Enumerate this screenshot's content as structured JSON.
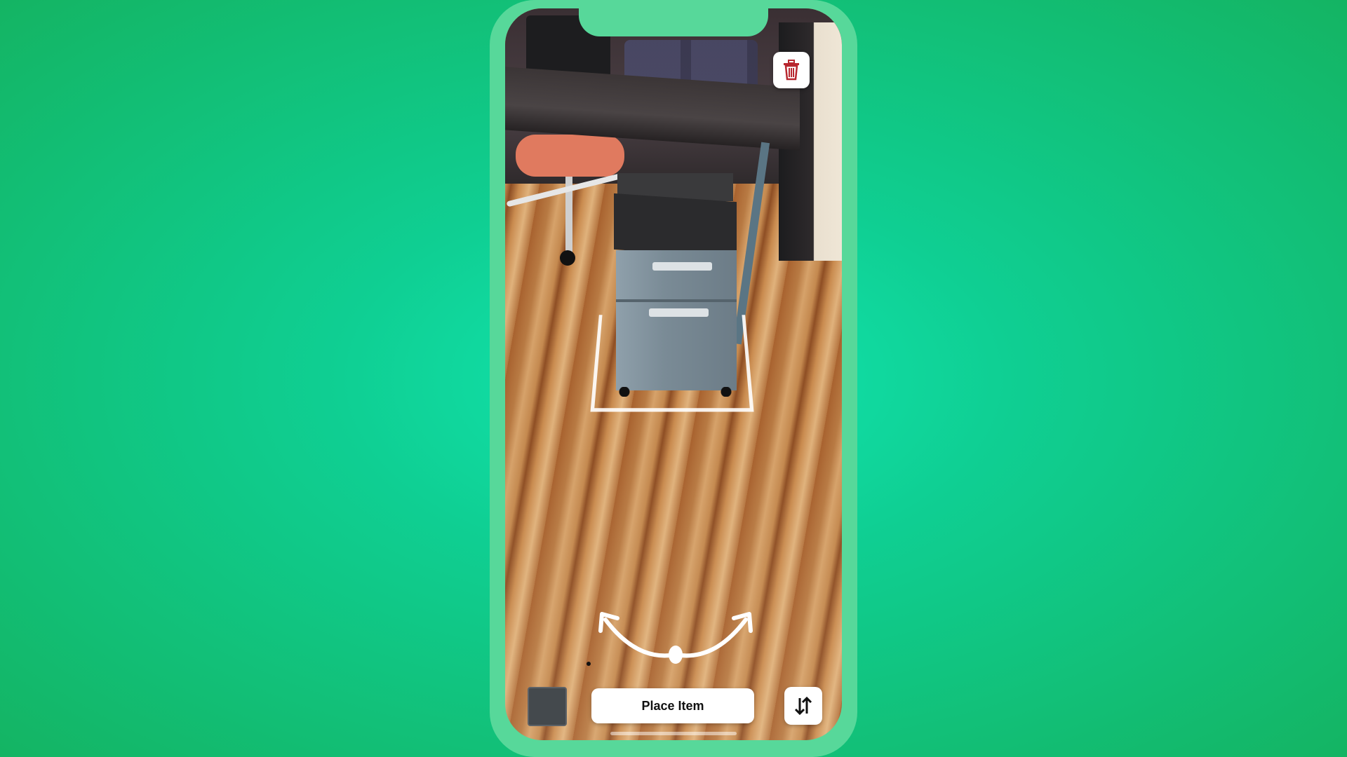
{
  "app": {
    "place_button_label": "Place Item"
  },
  "icons": {
    "trash": "trash-icon",
    "rotate": "rotate-gesture-icon",
    "swap": "swap-vertical-icon"
  },
  "colors": {
    "background_accent": "#12e6b0",
    "phone_frame": "#57d89a",
    "trash_icon": "#b8272f"
  }
}
